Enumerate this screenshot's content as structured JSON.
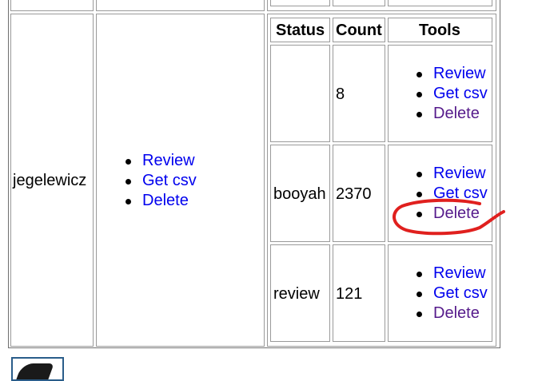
{
  "user": {
    "name": "jegelewicz",
    "actions": [
      "Review",
      "Get csv",
      "Delete"
    ]
  },
  "inner_table": {
    "headers": {
      "status": "Status",
      "count": "Count",
      "tools": "Tools"
    },
    "rows": [
      {
        "status": "",
        "count": "8",
        "tools": [
          "Review",
          "Get csv",
          "Delete"
        ]
      },
      {
        "status": "booyah",
        "count": "2370",
        "tools": [
          "Review",
          "Get csv",
          "Delete"
        ]
      },
      {
        "status": "review",
        "count": "121",
        "tools": [
          "Review",
          "Get csv",
          "Delete"
        ]
      }
    ]
  },
  "colors": {
    "link": "#0000ee",
    "visited_link": "#551a8b",
    "annotation": "#e0201e"
  }
}
